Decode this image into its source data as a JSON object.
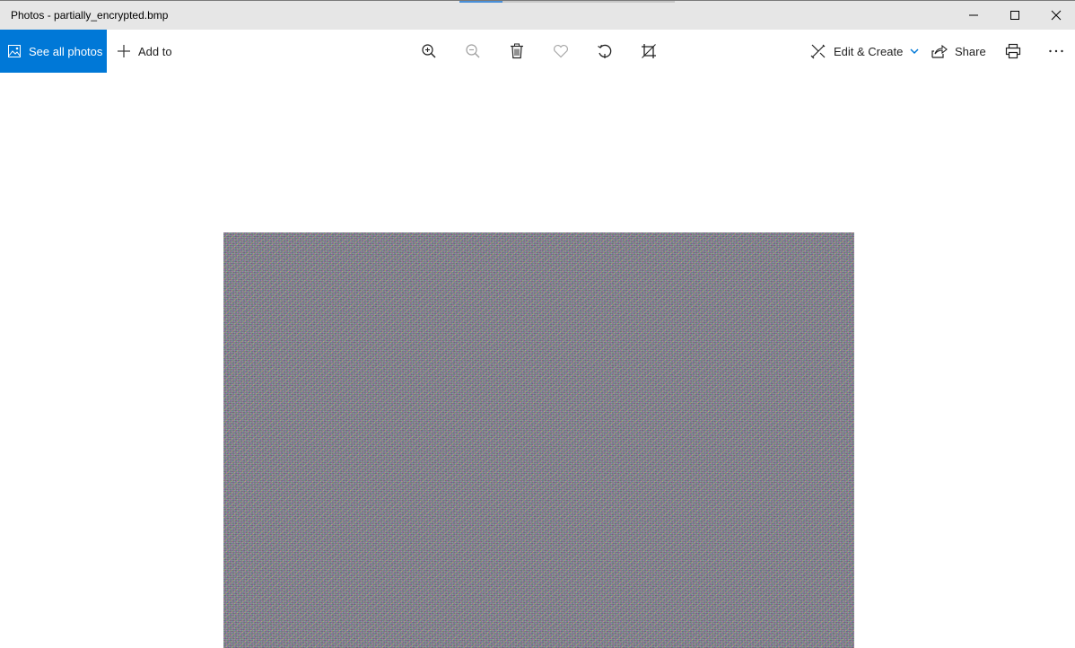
{
  "window": {
    "title": "Photos - partially_encrypted.bmp"
  },
  "toolbar": {
    "see_all_label": "See all photos",
    "add_to_label": "Add to",
    "edit_create_label": "Edit & Create",
    "share_label": "Share",
    "icons": [
      "zoom-in-icon",
      "zoom-out-icon",
      "delete-icon",
      "favorite-heart-icon",
      "rotate-icon",
      "crop-icon",
      "print-icon",
      "more-icon"
    ]
  },
  "colors": {
    "accent": "#0078d7",
    "titlebar": "#e6e6e6"
  }
}
